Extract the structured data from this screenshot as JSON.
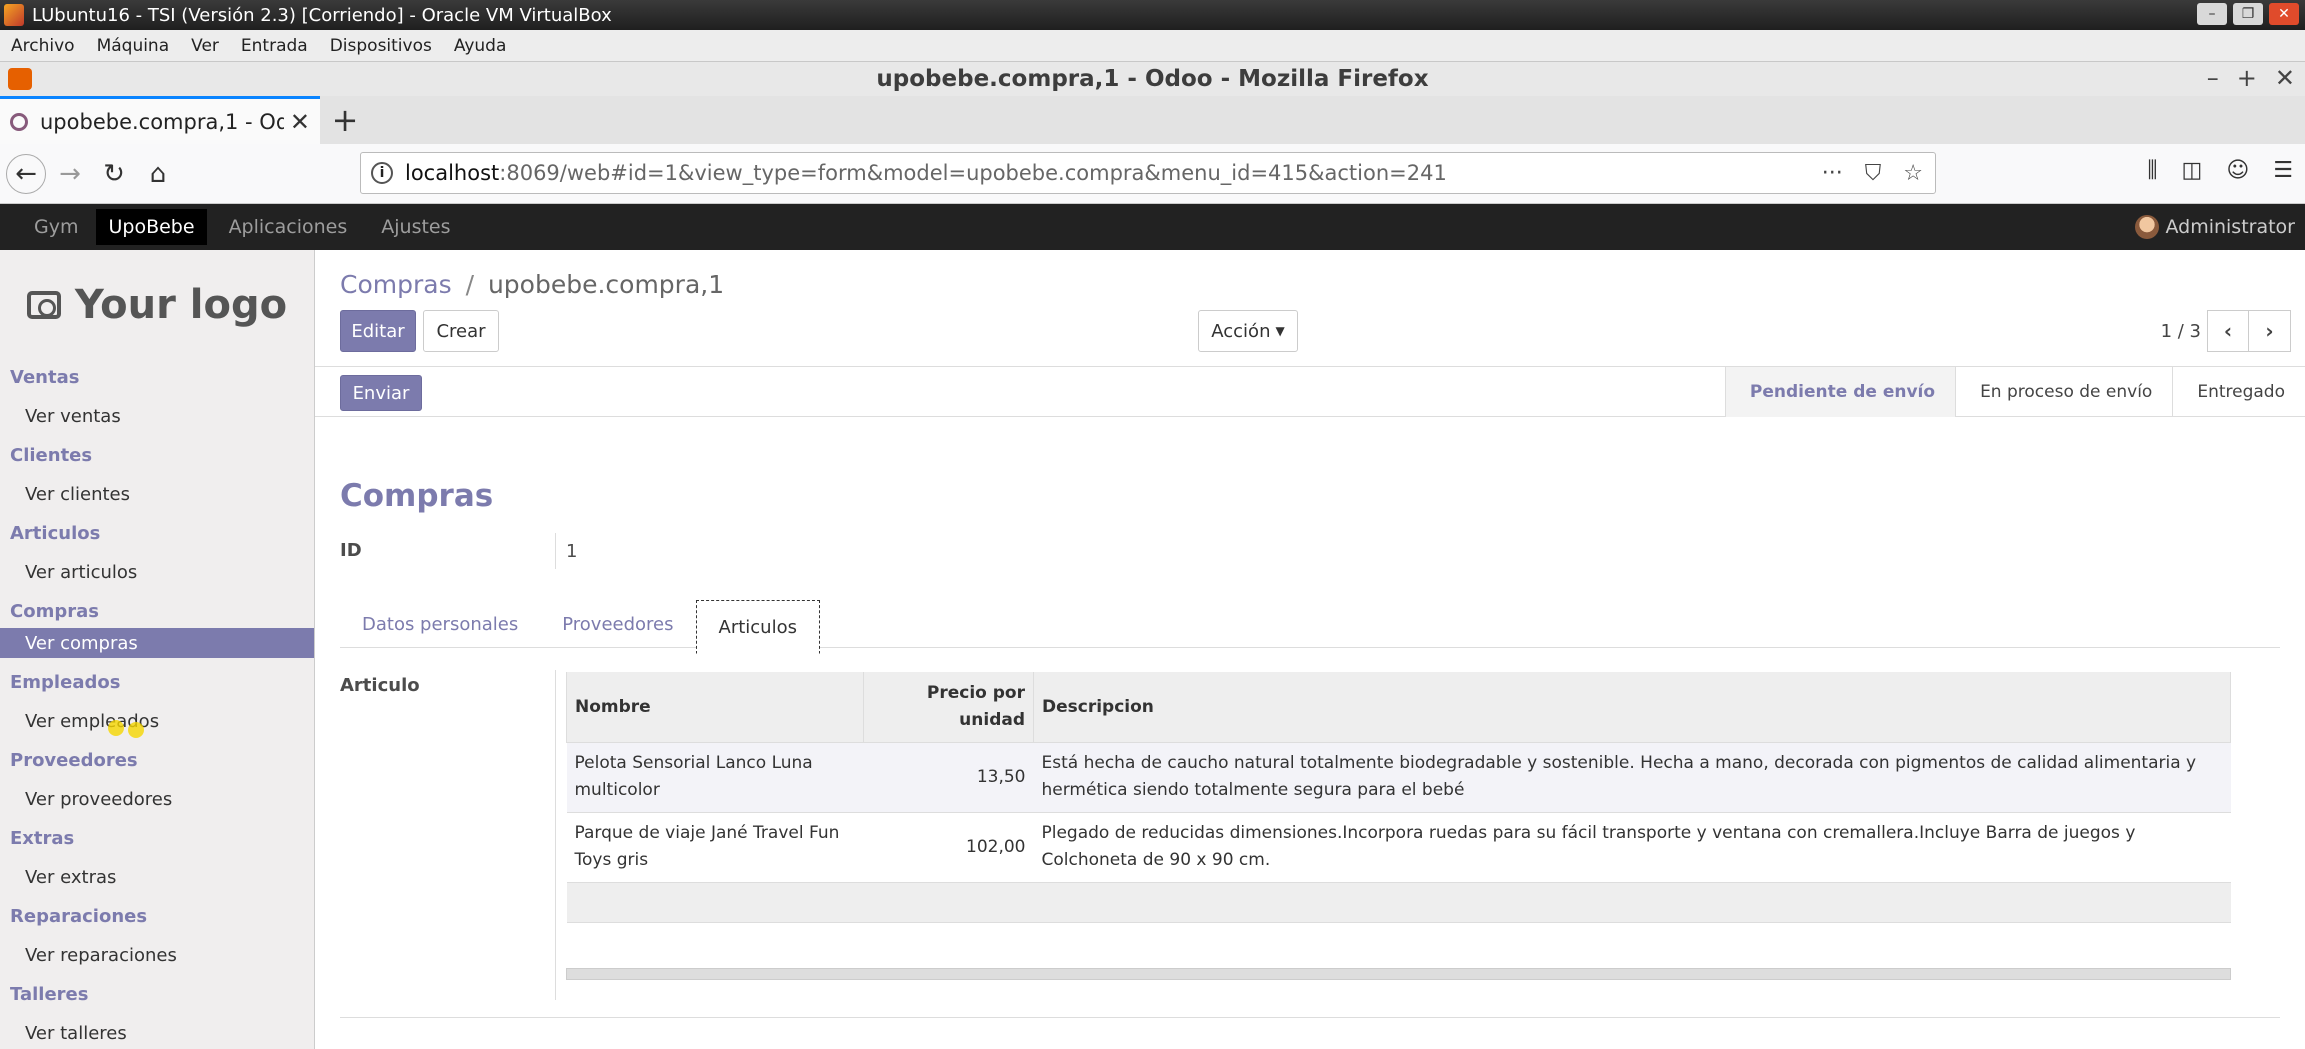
{
  "vbox": {
    "title": "LUbuntu16 - TSI (Versión 2.3) [Corriendo] - Oracle VM VirtualBox",
    "menu": [
      "Archivo",
      "Máquina",
      "Ver",
      "Entrada",
      "Dispositivos",
      "Ayuda"
    ]
  },
  "firefox": {
    "window_title": "upobebe.compra,1 - Odoo - Mozilla Firefox",
    "tab_title": "upobebe.compra,1 - Odoo - Mozilla Firefox",
    "url_host": "localhost",
    "url_path": ":8069/web#id=1&view_type=form&model=upobebe.compra&menu_id=415&action=241"
  },
  "odoo": {
    "apps": [
      "Gym",
      "UpoBebe",
      "Aplicaciones",
      "Ajustes"
    ],
    "active_app": "UpoBebe",
    "user": "Administrator",
    "logo_text": "Your logo",
    "sidebar": [
      {
        "head": "Ventas",
        "item": "Ver ventas"
      },
      {
        "head": "Clientes",
        "item": "Ver clientes"
      },
      {
        "head": "Articulos",
        "item": "Ver articulos"
      },
      {
        "head": "Compras",
        "item": "Ver compras",
        "active": true
      },
      {
        "head": "Empleados",
        "item": "Ver empleados"
      },
      {
        "head": "Proveedores",
        "item": "Ver proveedores"
      },
      {
        "head": "Extras",
        "item": "Ver extras"
      },
      {
        "head": "Reparaciones",
        "item": "Ver reparaciones"
      },
      {
        "head": "Talleres",
        "item": "Ver talleres"
      }
    ],
    "breadcrumb": {
      "parent": "Compras",
      "separator": "/",
      "current": "upobebe.compra,1"
    },
    "buttons": {
      "edit": "Editar",
      "create": "Crear",
      "action": "Acción",
      "send": "Enviar"
    },
    "pager": "1 / 3",
    "stages": [
      "Pendiente de envío",
      "En proceso de envío",
      "Entregado"
    ],
    "active_stage": "Pendiente de envío",
    "form": {
      "title": "Compras",
      "id_label": "ID",
      "id_value": "1",
      "tabs": [
        "Datos personales",
        "Proveedores",
        "Articulos"
      ],
      "active_tab": "Articulos",
      "articles_label": "Articulo",
      "columns": [
        "Nombre",
        "Precio por unidad",
        "Descripcion"
      ],
      "rows": [
        {
          "nombre": "Pelota Sensorial Lanco Luna multicolor",
          "precio": "13,50",
          "descripcion": "Está hecha de caucho natural totalmente biodegradable y sostenible. Hecha a mano, decorada con pigmentos de calidad alimentaria y hermética siendo totalmente segura para el bebé"
        },
        {
          "nombre": "Parque de viaje Jané Travel Fun Toys gris",
          "precio": "102,00",
          "descripcion": "Plegado de reducidas dimensiones.Incorpora ruedas para su fácil transporte y ventana con cremallera.Incluye Barra de juegos y Colchoneta de 90 x 90 cm."
        }
      ]
    }
  },
  "colors": {
    "odoo_accent": "#7c7bad",
    "topbar": "#222222"
  }
}
